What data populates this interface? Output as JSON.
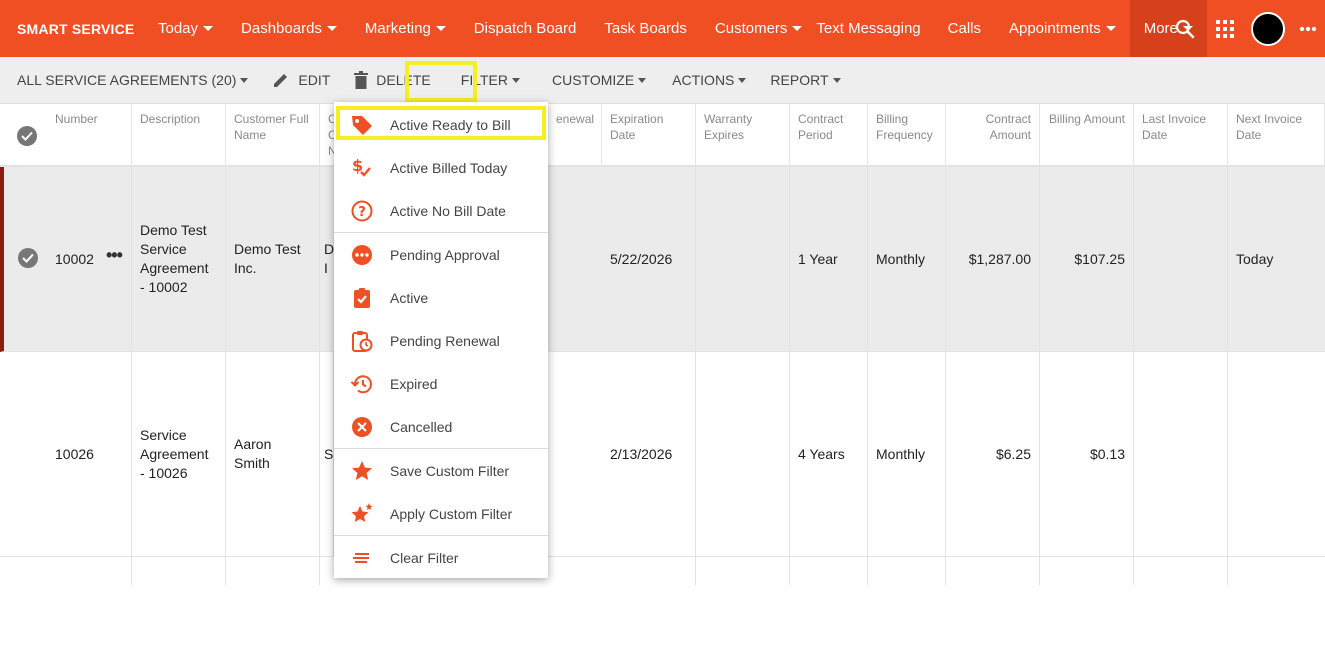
{
  "app": {
    "brand": "SMART SERVICE",
    "accent": "#f04e23",
    "highlight": "#f6ee20"
  },
  "nav": {
    "items": [
      {
        "label": "Today",
        "dropdown": true
      },
      {
        "label": "Dashboards",
        "dropdown": true
      },
      {
        "label": "Marketing",
        "dropdown": true
      },
      {
        "label": "Dispatch Board",
        "dropdown": false
      },
      {
        "label": "Task Boards",
        "dropdown": false
      },
      {
        "label": "Customers",
        "dropdown": true
      },
      {
        "label": "Text Messaging",
        "dropdown": false
      },
      {
        "label": "Calls",
        "dropdown": false
      },
      {
        "label": "Appointments",
        "dropdown": true
      },
      {
        "label": "More",
        "dropdown": true
      }
    ],
    "icons": [
      "search-icon",
      "apps-grid-icon",
      "avatar",
      "more-horizontal-icon"
    ]
  },
  "toolbar": {
    "view_label": "ALL SERVICE AGREEMENTS (20)",
    "edit_label": "EDIT",
    "delete_label": "DELETE",
    "filter_label": "FILTER",
    "customize_label": "CUSTOMIZE",
    "actions_label": "ACTIONS",
    "report_label": "REPORT"
  },
  "columns": {
    "number": "Number",
    "description": "Description",
    "customer": "Customer Full Name",
    "company_partial": "C C N",
    "renewal_partial": "enewal",
    "expiration": "Expiration Date",
    "warranty": "Warranty Expires",
    "period": "Contract Period",
    "frequency": "Billing Frequency",
    "contract_amount": "Contract Amount",
    "billing_amount": "Billing Amount",
    "last_invoice": "Last Invoice Date",
    "next_invoice": "Next Invoice Date"
  },
  "rows": [
    {
      "number": "10002",
      "description": "Demo Test Service Agreement - 10002",
      "customer": "Demo Test Inc.",
      "company_partial": "D I",
      "expiration": "5/22/2026",
      "period": "1 Year",
      "frequency": "Monthly",
      "contract_amount": "$1,287.00",
      "billing_amount": "$107.25",
      "next_invoice": "Today",
      "selected": true
    },
    {
      "number": "10026",
      "description": "Service Agreement - 10026",
      "customer": "Aaron Smith",
      "company_partial": "S",
      "expiration": "2/13/2026",
      "period": "4 Years",
      "frequency": "Monthly",
      "contract_amount": "$6.25",
      "billing_amount": "$0.13",
      "next_invoice": "",
      "selected": false
    }
  ],
  "filter_menu": {
    "items": [
      {
        "label": "Active Ready to Bill",
        "icon": "tag-icon",
        "highlighted": true
      },
      {
        "label": "Active Billed Today",
        "icon": "billed-check-icon"
      },
      {
        "label": "Active No Bill Date",
        "icon": "question-circle-icon"
      },
      {
        "label": "Pending Approval",
        "icon": "dots-circle-icon"
      },
      {
        "label": "Active",
        "icon": "clipboard-check-icon"
      },
      {
        "label": "Pending Renewal",
        "icon": "clipboard-clock-icon"
      },
      {
        "label": "Expired",
        "icon": "history-icon"
      },
      {
        "label": "Cancelled",
        "icon": "close-circle-icon"
      },
      {
        "label": "Save Custom Filter",
        "icon": "star-icon"
      },
      {
        "label": "Apply Custom Filter",
        "icon": "stars-icon"
      },
      {
        "label": "Clear Filter",
        "icon": "clear-lines-icon"
      }
    ]
  }
}
